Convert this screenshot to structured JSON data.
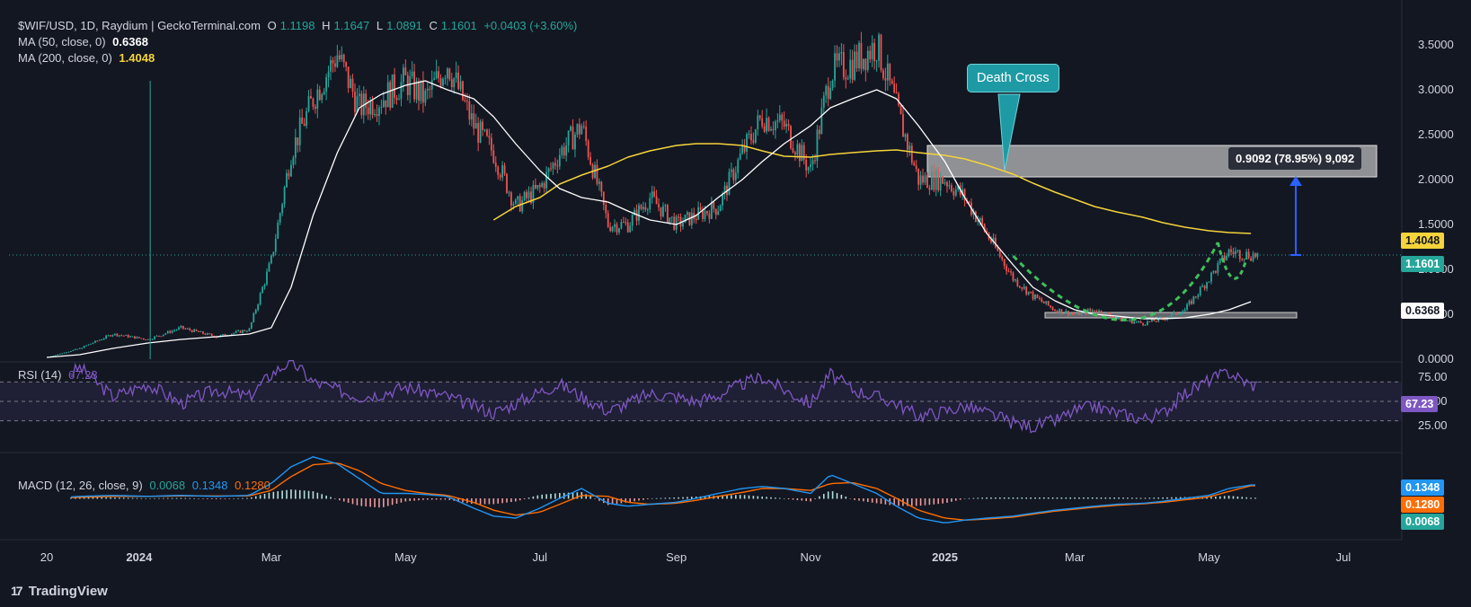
{
  "header": {
    "symbol": "$WIF/USD, 1D, Raydium | GeckoTerminal.com",
    "o_label": "O",
    "o_value": "1.1198",
    "h_label": "H",
    "h_value": "1.1647",
    "l_label": "L",
    "l_value": "1.0891",
    "c_label": "C",
    "c_value": "1.1601",
    "change": "+0.0403 (+3.60%)"
  },
  "indicators": {
    "ma50_label": "MA (50, close, 0)",
    "ma50_value": "0.6368",
    "ma200_label": "MA (200, close, 0)",
    "ma200_value": "1.4048",
    "rsi_label": "RSI (14)",
    "rsi_value": "67.23",
    "macd_label": "MACD (12, 26, close, 9)",
    "macd_hist": "0.0068",
    "macd_line": "0.1348",
    "macd_signal": "0.1280"
  },
  "price_tags": {
    "ma200": "1.4048",
    "close": "1.1601",
    "ma50": "0.6368"
  },
  "annotations": {
    "death_cross": "Death Cross",
    "measure": "0.9092 (78.95%) 9,092"
  },
  "brand": "TradingView",
  "colors": {
    "up": "#26a69a",
    "down": "#ef5350",
    "ma50": "#ffffff",
    "ma200": "#f5d33a",
    "rsi": "#7e57c2",
    "macd": "#2196f3",
    "signal": "#ff6d00",
    "cup": "#3fbf5a",
    "callout": "#1e9aa4",
    "arrow": "#2962ff"
  },
  "chart_data": [
    {
      "type": "line",
      "title": "$WIF/USD, 1D, Raydium | GeckoTerminal.com",
      "x_tick_labels": [
        "20",
        "2024",
        "Mar",
        "May",
        "Jul",
        "Sep",
        "Nov",
        "2025",
        "Mar",
        "May",
        "Jul"
      ],
      "y_tick_labels": [
        "0.0000",
        "0.5000",
        "1.0000",
        "1.5000",
        "2.0000",
        "2.5000",
        "3.0000",
        "3.5000"
      ],
      "ylim": [
        0,
        3.9
      ],
      "x": [
        "2023-11-20",
        "2023-12-05",
        "2023-12-20",
        "2024-01-05",
        "2024-01-20",
        "2024-02-05",
        "2024-02-20",
        "2024-03-01",
        "2024-03-10",
        "2024-03-20",
        "2024-03-31",
        "2024-04-10",
        "2024-04-20",
        "2024-05-01",
        "2024-05-10",
        "2024-05-20",
        "2024-06-01",
        "2024-06-10",
        "2024-06-20",
        "2024-07-01",
        "2024-07-10",
        "2024-07-20",
        "2024-08-01",
        "2024-08-10",
        "2024-08-20",
        "2024-09-01",
        "2024-09-10",
        "2024-09-20",
        "2024-10-01",
        "2024-10-10",
        "2024-10-20",
        "2024-11-01",
        "2024-11-10",
        "2024-11-20",
        "2024-12-01",
        "2024-12-10",
        "2024-12-20",
        "2025-01-01",
        "2025-01-10",
        "2025-01-20",
        "2025-02-01",
        "2025-02-10",
        "2025-02-20",
        "2025-03-01",
        "2025-03-10",
        "2025-03-20",
        "2025-04-01",
        "2025-04-10",
        "2025-04-20",
        "2025-05-01",
        "2025-05-10",
        "2025-05-20"
      ],
      "series": [
        {
          "name": "$WIF/USD",
          "values": [
            0.02,
            0.12,
            0.28,
            0.22,
            0.35,
            0.25,
            0.33,
            1.1,
            2.3,
            2.9,
            3.4,
            2.8,
            2.9,
            3.1,
            2.9,
            3.3,
            2.6,
            2.3,
            1.7,
            1.9,
            2.3,
            2.6,
            1.5,
            1.5,
            1.8,
            1.5,
            1.6,
            1.7,
            2.3,
            2.7,
            2.6,
            2.1,
            3.2,
            3.3,
            3.5,
            2.8,
            2.0,
            2.0,
            1.8,
            1.4,
            0.9,
            0.7,
            0.55,
            0.5,
            0.55,
            0.45,
            0.4,
            0.45,
            0.55,
            0.9,
            1.2,
            1.16
          ]
        },
        {
          "name": "MA (50, close, 0)",
          "values": [
            0.02,
            0.05,
            0.12,
            0.18,
            0.22,
            0.25,
            0.28,
            0.35,
            0.8,
            1.6,
            2.3,
            2.8,
            2.95,
            3.05,
            3.1,
            3.0,
            2.9,
            2.7,
            2.4,
            2.1,
            1.9,
            1.8,
            1.75,
            1.65,
            1.55,
            1.5,
            1.6,
            1.8,
            2.0,
            2.2,
            2.4,
            2.6,
            2.8,
            2.9,
            3.0,
            2.9,
            2.6,
            2.2,
            1.8,
            1.4,
            1.05,
            0.8,
            0.65,
            0.55,
            0.5,
            0.48,
            0.45,
            0.45,
            0.46,
            0.5,
            0.55,
            0.64
          ]
        },
        {
          "name": "MA (200, close, 0)",
          "values": [
            null,
            null,
            null,
            null,
            null,
            null,
            null,
            null,
            null,
            null,
            null,
            null,
            null,
            null,
            null,
            null,
            null,
            1.55,
            1.7,
            1.8,
            1.95,
            2.05,
            2.15,
            2.25,
            2.32,
            2.38,
            2.4,
            2.4,
            2.38,
            2.32,
            2.26,
            2.25,
            2.28,
            2.3,
            2.32,
            2.33,
            2.3,
            2.27,
            2.23,
            2.16,
            2.06,
            1.96,
            1.86,
            1.78,
            1.7,
            1.64,
            1.58,
            1.52,
            1.47,
            1.43,
            1.41,
            1.4
          ]
        }
      ]
    },
    {
      "type": "line",
      "title": "RSI (14)",
      "y_tick_labels": [
        "25.00",
        "50.00",
        "75.00"
      ],
      "ylim": [
        18,
        92
      ],
      "bands": [
        30,
        50,
        70
      ],
      "series": [
        {
          "name": "RSI (14)",
          "values": [
            60,
            85,
            55,
            68,
            48,
            62,
            55,
            78,
            92,
            70,
            62,
            55,
            58,
            65,
            60,
            55,
            45,
            38,
            48,
            60,
            68,
            55,
            40,
            48,
            58,
            55,
            50,
            56,
            68,
            75,
            62,
            48,
            78,
            62,
            55,
            48,
            35,
            40,
            45,
            38,
            28,
            24,
            30,
            40,
            45,
            38,
            32,
            38,
            58,
            72,
            80,
            67
          ]
        }
      ]
    },
    {
      "type": "line",
      "title": "MACD (12, 26, close, 9)",
      "series": [
        {
          "name": "MACD",
          "values": [
            0.0,
            0.02,
            0.03,
            0.02,
            0.03,
            0.02,
            0.03,
            0.15,
            0.32,
            0.42,
            0.35,
            0.2,
            0.05,
            0.05,
            0.04,
            0.02,
            -0.1,
            -0.18,
            -0.2,
            -0.1,
            0.0,
            0.1,
            -0.05,
            -0.08,
            -0.06,
            -0.04,
            0.0,
            0.05,
            0.1,
            0.12,
            0.1,
            0.05,
            0.24,
            0.15,
            0.05,
            -0.08,
            -0.2,
            -0.25,
            -0.22,
            -0.2,
            -0.18,
            -0.15,
            -0.12,
            -0.1,
            -0.08,
            -0.06,
            -0.05,
            -0.03,
            0.0,
            0.03,
            0.1,
            0.135
          ]
        },
        {
          "name": "Signal",
          "values": [
            0.0,
            0.01,
            0.02,
            0.02,
            0.025,
            0.025,
            0.025,
            0.08,
            0.22,
            0.34,
            0.36,
            0.28,
            0.15,
            0.08,
            0.05,
            0.03,
            -0.04,
            -0.12,
            -0.17,
            -0.14,
            -0.06,
            0.03,
            0.02,
            -0.04,
            -0.06,
            -0.05,
            -0.02,
            0.02,
            0.06,
            0.1,
            0.1,
            0.08,
            0.15,
            0.16,
            0.1,
            0.0,
            -0.12,
            -0.2,
            -0.22,
            -0.21,
            -0.19,
            -0.16,
            -0.13,
            -0.11,
            -0.09,
            -0.07,
            -0.055,
            -0.04,
            -0.015,
            0.015,
            0.07,
            0.128
          ]
        }
      ]
    }
  ]
}
